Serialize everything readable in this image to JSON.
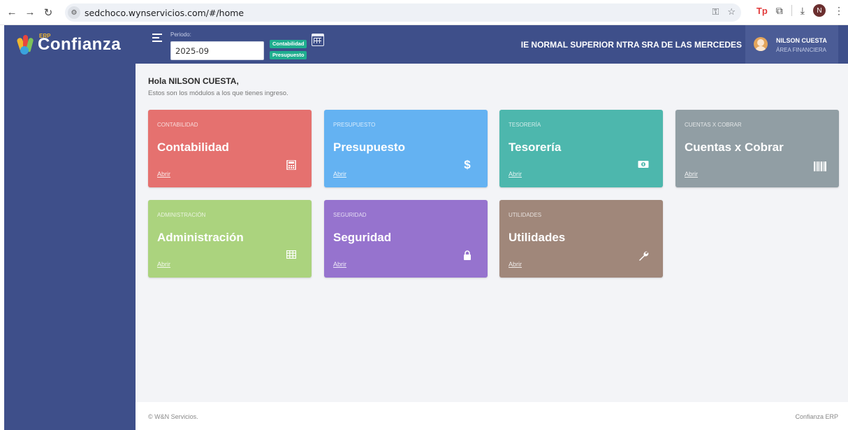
{
  "browser": {
    "url": "sedchoco.wynservicios.com/#/home",
    "profile_initial": "N"
  },
  "header": {
    "logo_erp": "ERP",
    "logo_text": "Confianza",
    "periodo_label": "Periodo:",
    "periodo_value": "2025-09",
    "badge_contabilidad": "Contabilidad",
    "badge_presupuesto": "Presupuesto",
    "institution": "IE NORMAL SUPERIOR NTRA SRA DE LAS MERCEDES",
    "user_name": "NILSON CUESTA",
    "user_role": "ÁREA FINANCIERA"
  },
  "main": {
    "greeting": "Hola NILSON CUESTA,",
    "subtitle": "Estos son los módulos a los que tienes ingreso.",
    "cards": [
      {
        "category": "CONTABILIDAD",
        "title": "Contabilidad",
        "link": "Abrir",
        "icon": "calculator-icon",
        "color": "#e5716f"
      },
      {
        "category": "PRESUPUESTO",
        "title": "Presupuesto",
        "link": "Abrir",
        "icon": "dollar-icon",
        "color": "#64b2f2"
      },
      {
        "category": "TESORERÍA",
        "title": "Tesorería",
        "link": "Abrir",
        "icon": "money-icon",
        "color": "#4db7ad"
      },
      {
        "category": "CUENTAS X COBRAR",
        "title": "Cuentas x Cobrar",
        "link": "Abrir",
        "icon": "barcode-icon",
        "color": "#919ea4"
      },
      {
        "category": "ADMINISTRACIÓN",
        "title": "Administración",
        "link": "Abrir",
        "icon": "table-icon",
        "color": "#abd37e"
      },
      {
        "category": "SEGURIDAD",
        "title": "Seguridad",
        "link": "Abrir",
        "icon": "lock-icon",
        "color": "#9673ce"
      },
      {
        "category": "UTILIDADES",
        "title": "Utilidades",
        "link": "Abrir",
        "icon": "wrench-icon",
        "color": "#a0877a"
      }
    ]
  },
  "footer": {
    "left": "© W&N Servicios.",
    "right": "Confianza ERP"
  }
}
